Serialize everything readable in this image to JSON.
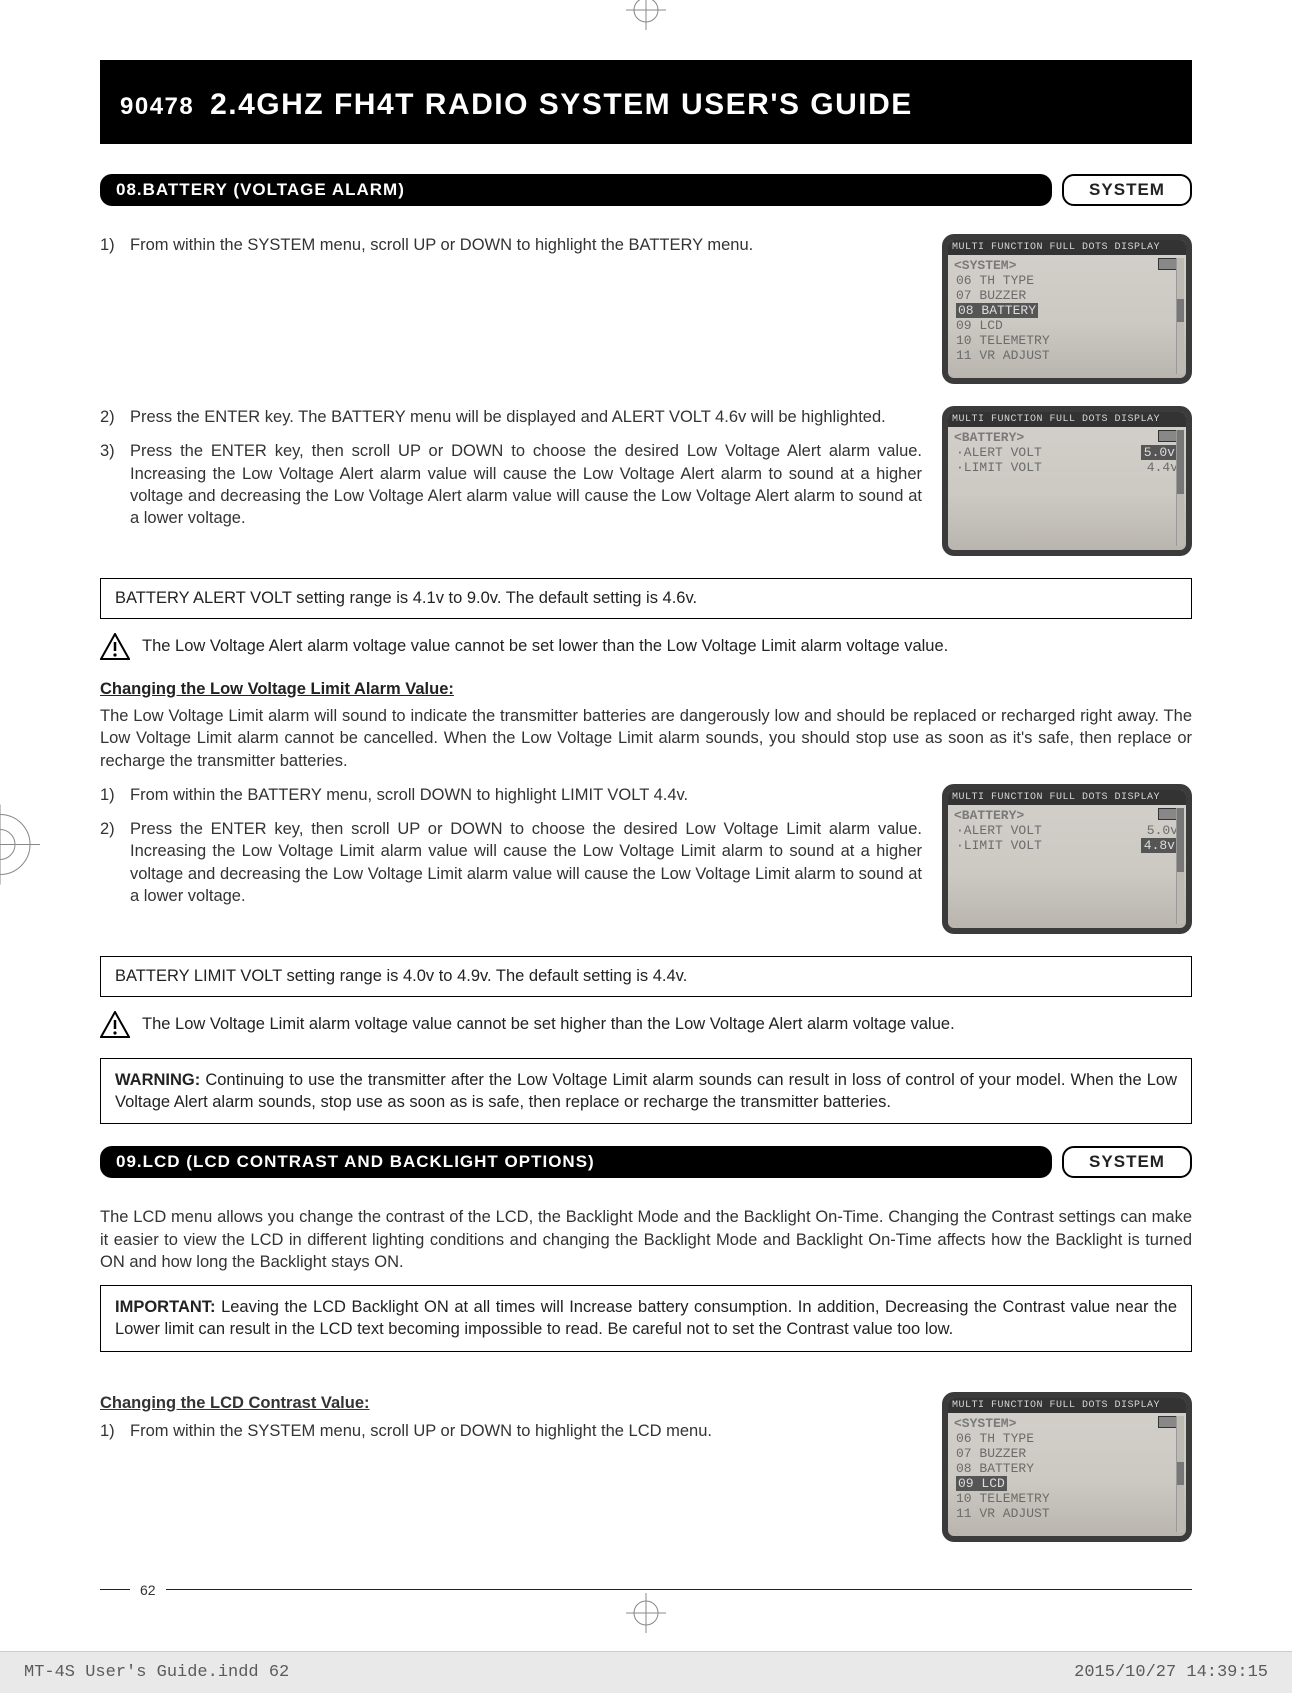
{
  "header": {
    "product_code": "90478",
    "title": "2.4GHZ FH4T RADIO SYSTEM USER'S GUIDE"
  },
  "section08": {
    "title": "08.BATTERY (VOLTAGE ALARM)",
    "tag": "SYSTEM",
    "step1": "From within the SYSTEM menu, scroll UP or DOWN to highlight the BATTERY menu.",
    "step2": "Press the ENTER key. The BATTERY menu will be displayed and ALERT VOLT 4.6v will be highlighted.",
    "step3": "Press the ENTER key, then scroll UP or DOWN to choose the desired Low Voltage Alert alarm value. Increasing the Low Voltage Alert alarm value will cause the Low Voltage Alert alarm to sound at a higher voltage and decreasing the Low Voltage Alert alarm value will cause the Low Voltage Alert alarm to sound at a lower voltage.",
    "range": "BATTERY ALERT VOLT setting range is 4.1v to 9.0v. The default setting is 4.6v.",
    "warn": "The Low Voltage Alert alarm voltage value cannot be set lower than the Low Voltage Limit alarm voltage value.",
    "sub_heading": "Changing the Low Voltage Limit Alarm Value:",
    "para": "The Low Voltage Limit alarm will sound to indicate the transmitter batteries are dangerously low and should be replaced or recharged right away. The Low Voltage Limit alarm cannot be cancelled. When the Low Voltage Limit alarm sounds, you should stop use as soon as it's safe, then replace or recharge the transmitter batteries.",
    "limit_step1": "From within the BATTERY menu, scroll DOWN to highlight LIMIT VOLT 4.4v.",
    "limit_step2": "Press the ENTER key, then scroll UP or DOWN to choose the desired Low Voltage Limit alarm value. Increasing the Low Voltage Limit alarm value will cause the Low Voltage Limit alarm to sound at a higher voltage and decreasing the Low Voltage Limit alarm value will cause the Low Voltage Limit alarm to sound at a lower voltage.",
    "limit_range": "BATTERY LIMIT VOLT setting range is 4.0v to 4.9v. The default setting is 4.4v.",
    "limit_warn": "The Low Voltage Limit alarm voltage value cannot be set higher than the Low Voltage Alert alarm voltage value.",
    "warning_label": "WARNING:",
    "warning_text": " Continuing to use the transmitter after the Low Voltage Limit alarm sounds can result in loss of control of your model. When the Low Voltage Alert alarm sounds, stop use as soon as is safe, then replace or recharge the transmitter batteries."
  },
  "section09": {
    "title": "09.LCD (LCD CONTRAST AND BACKLIGHT OPTIONS)",
    "tag": "SYSTEM",
    "intro": "The LCD menu allows you change the contrast of the LCD, the Backlight Mode and the Backlight On-Time. Changing the Contrast settings can make it easier to view the LCD in different lighting conditions and changing the Backlight Mode and Backlight On-Time affects how the Backlight is turned ON and how long the Backlight stays ON.",
    "important_label": "IMPORTANT:",
    "important_text": " Leaving the LCD Backlight ON at all times will Increase battery consumption. In addition, Decreasing the Contrast value near the Lower limit can result in the LCD text becoming impossible to read. Be careful not to set the Contrast value too low.",
    "sub_heading": "Changing the LCD Contrast Value:",
    "step1": "From within the SYSTEM menu, scroll UP or DOWN to highlight the LCD menu."
  },
  "lcds": {
    "title": "MULTI FUNCTION FULL DOTS DISPLAY",
    "system": {
      "head": "<SYSTEM>",
      "items": [
        "06 TH TYPE",
        "07 BUZZER",
        "08 BATTERY",
        "09 LCD",
        "10 TELEMETRY",
        "11 VR ADJUST"
      ],
      "hl_index_battery": 2,
      "hl_index_lcd": 3
    },
    "battery_alert": {
      "head": "<BATTERY>",
      "rows": [
        {
          "label": "·ALERT VOLT",
          "val": "5.0v",
          "hl": true
        },
        {
          "label": "·LIMIT VOLT",
          "val": "4.4v",
          "hl": false
        }
      ]
    },
    "battery_limit": {
      "head": "<BATTERY>",
      "rows": [
        {
          "label": "·ALERT VOLT",
          "val": "5.0v",
          "hl": false
        },
        {
          "label": "·LIMIT VOLT",
          "val": "4.8v",
          "hl": true
        }
      ]
    }
  },
  "page_number": "62",
  "footer": {
    "left": "MT-4S User's Guide.indd   62",
    "right": "2015/10/27   14:39:15"
  }
}
